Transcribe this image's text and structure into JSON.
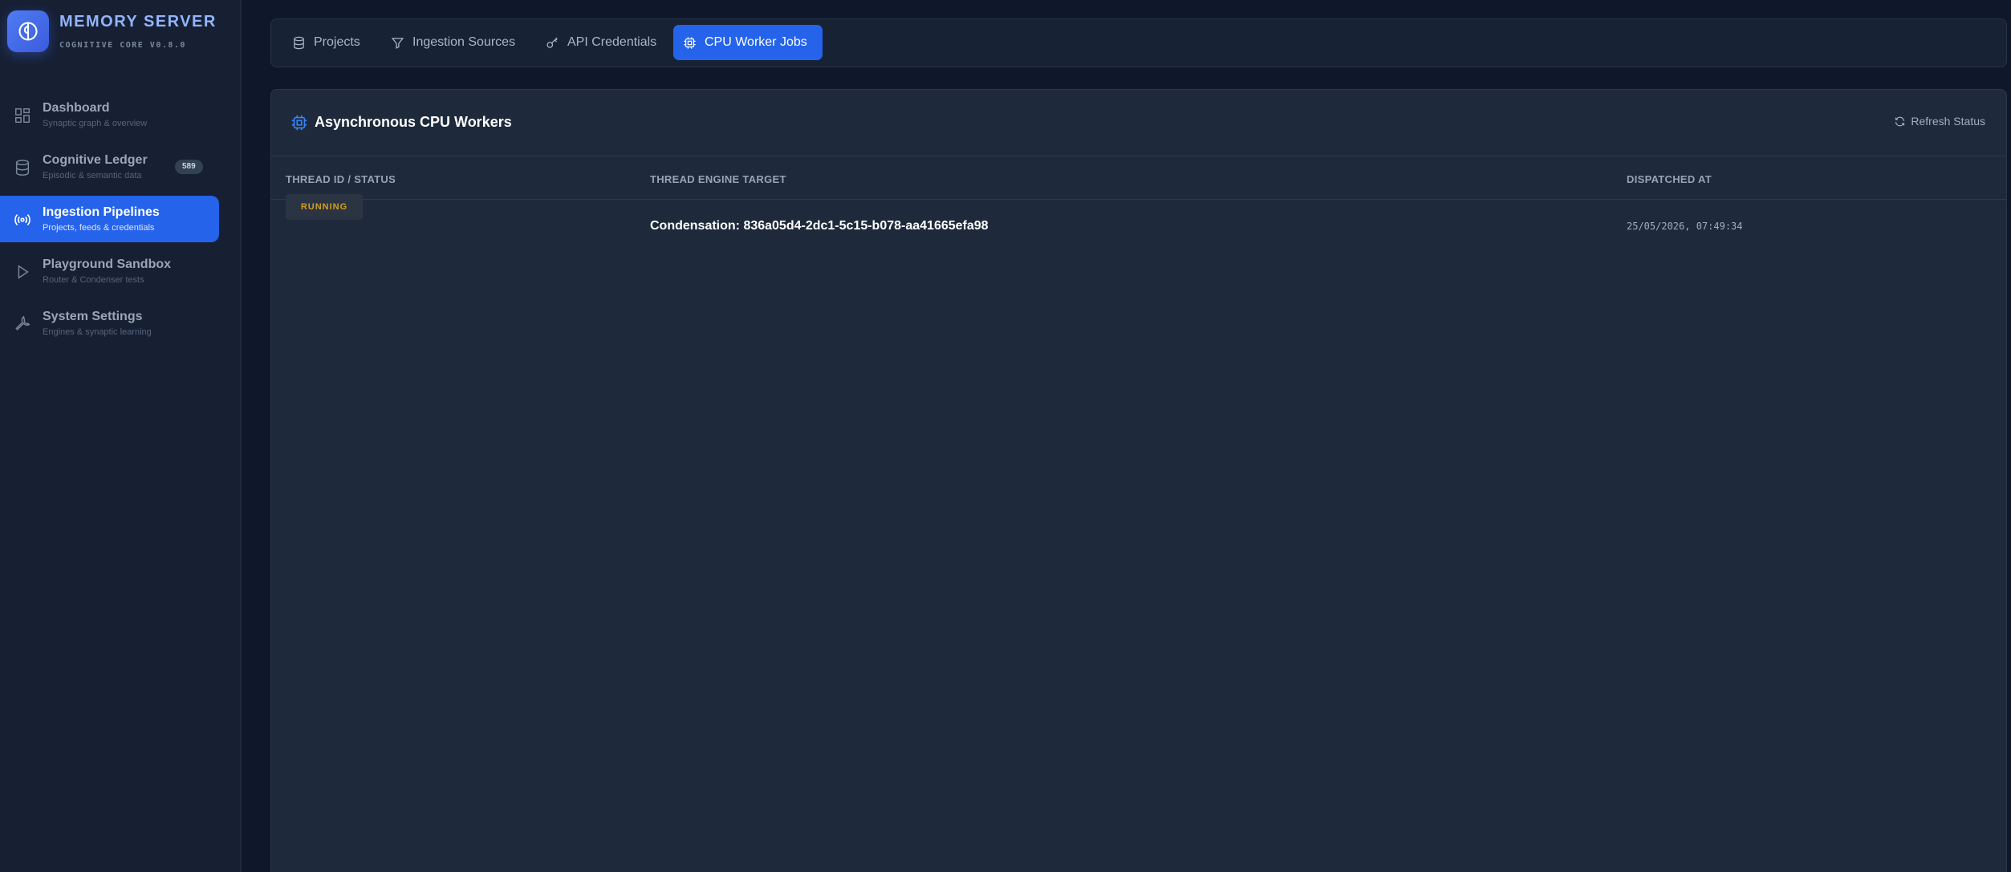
{
  "brand": {
    "title": "MEMORY SERVER",
    "subtitle": "COGNITIVE CORE V0.8.0"
  },
  "sidebar": {
    "items": [
      {
        "label": "Dashboard",
        "desc": "Synaptic graph & overview",
        "icon": "grid-icon",
        "active": false
      },
      {
        "label": "Cognitive Ledger",
        "desc": "Episodic & semantic data",
        "icon": "database-icon",
        "badge": "589",
        "active": false
      },
      {
        "label": "Ingestion Pipelines",
        "desc": "Projects, feeds & credentials",
        "icon": "broadcast-icon",
        "active": true
      },
      {
        "label": "Playground Sandbox",
        "desc": "Router & Condenser tests",
        "icon": "play-icon",
        "active": false
      },
      {
        "label": "System Settings",
        "desc": "Engines & synaptic learning",
        "icon": "wrench-icon",
        "active": false
      }
    ]
  },
  "tabs": [
    {
      "label": "Projects",
      "icon": "database-icon"
    },
    {
      "label": "Ingestion Sources",
      "icon": "filter-icon"
    },
    {
      "label": "API Credentials",
      "icon": "key-icon"
    },
    {
      "label": "CPU Worker Jobs",
      "icon": "cpu-icon",
      "active": true
    }
  ],
  "panel": {
    "title": "Asynchronous CPU Workers",
    "refresh_label": "Refresh Status",
    "columns": [
      "THREAD ID / STATUS",
      "THREAD ENGINE TARGET",
      "DISPATCHED AT"
    ],
    "rows": [
      {
        "status": "RUNNING",
        "target": "Condensation: 836a05d4-2dc1-5c15-b078-aa41665efa98",
        "dispatched_at": "25/05/2026, 07:49:34"
      }
    ]
  },
  "colors": {
    "accent": "#2563eb",
    "status_running": "#d4a017",
    "background": "#0f172a",
    "panel": "#1e293b"
  }
}
